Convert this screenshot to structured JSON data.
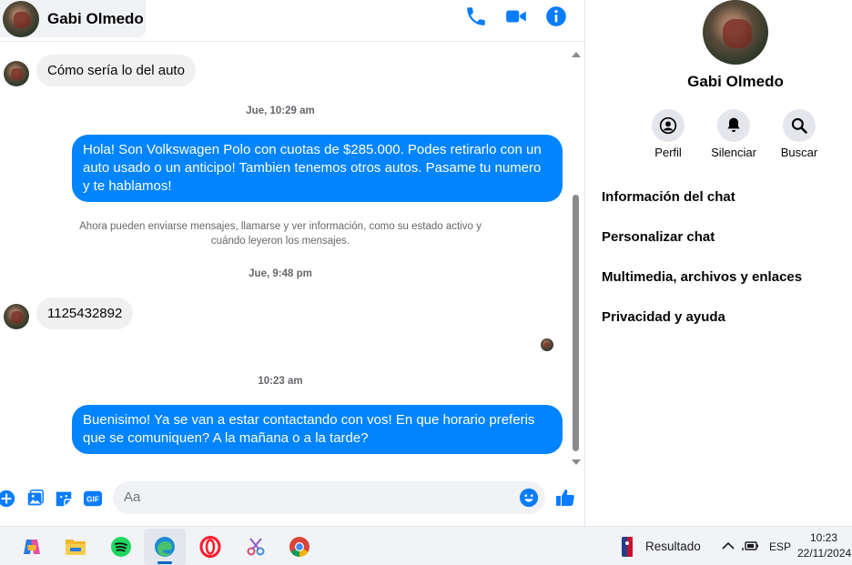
{
  "contact": {
    "name": "Gabi Olmedo"
  },
  "header_icons": [
    "phone-icon",
    "video-icon",
    "info-icon"
  ],
  "colors": {
    "accent": "#0084ff",
    "incoming_bubble": "#f0f0f0",
    "icon_blue": "#0a7cff"
  },
  "messages": {
    "m1": "Cómo sería lo del auto",
    "ts1": "Jue, 10:29 am",
    "m2": "Hola! Son Volkswagen Polo con cuotas de $285.000. Podes retirarlo con un auto usado o un anticipo! Tambien tenemos otros autos. Pasame tu numero y te hablamos!",
    "notice": "Ahora pueden enviarse mensajes, llamarse y ver información, como su estado activo y cuándo leyeron los mensajes.",
    "ts2": "Jue, 9:48 pm",
    "m3": "1125432892",
    "ts3": "10:23 am",
    "m4": "Buenisimo! Ya se van a estar contactando con vos! En que horario preferis que se comuniquen? A la mañana o a la tarde?"
  },
  "composer": {
    "placeholder": "Aa"
  },
  "info_panel": {
    "name": "Gabi Olmedo",
    "actions": [
      {
        "label": "Perfil",
        "icon": "profile-icon"
      },
      {
        "label": "Silenciar",
        "icon": "bell-icon"
      },
      {
        "label": "Buscar",
        "icon": "search-icon"
      }
    ],
    "menu": [
      "Información del chat",
      "Personalizar chat",
      "Multimedia, archivos y enlaces",
      "Privacidad y ayuda"
    ]
  },
  "taskbar": {
    "apps": [
      "copilot-icon",
      "file-explorer-icon",
      "spotify-icon",
      "edge-icon",
      "opera-icon",
      "snipping-tool-icon",
      "chrome-icon"
    ],
    "widget_label": "Resultado",
    "language": "ESP",
    "time": "10:23",
    "date": "22/11/2024"
  }
}
